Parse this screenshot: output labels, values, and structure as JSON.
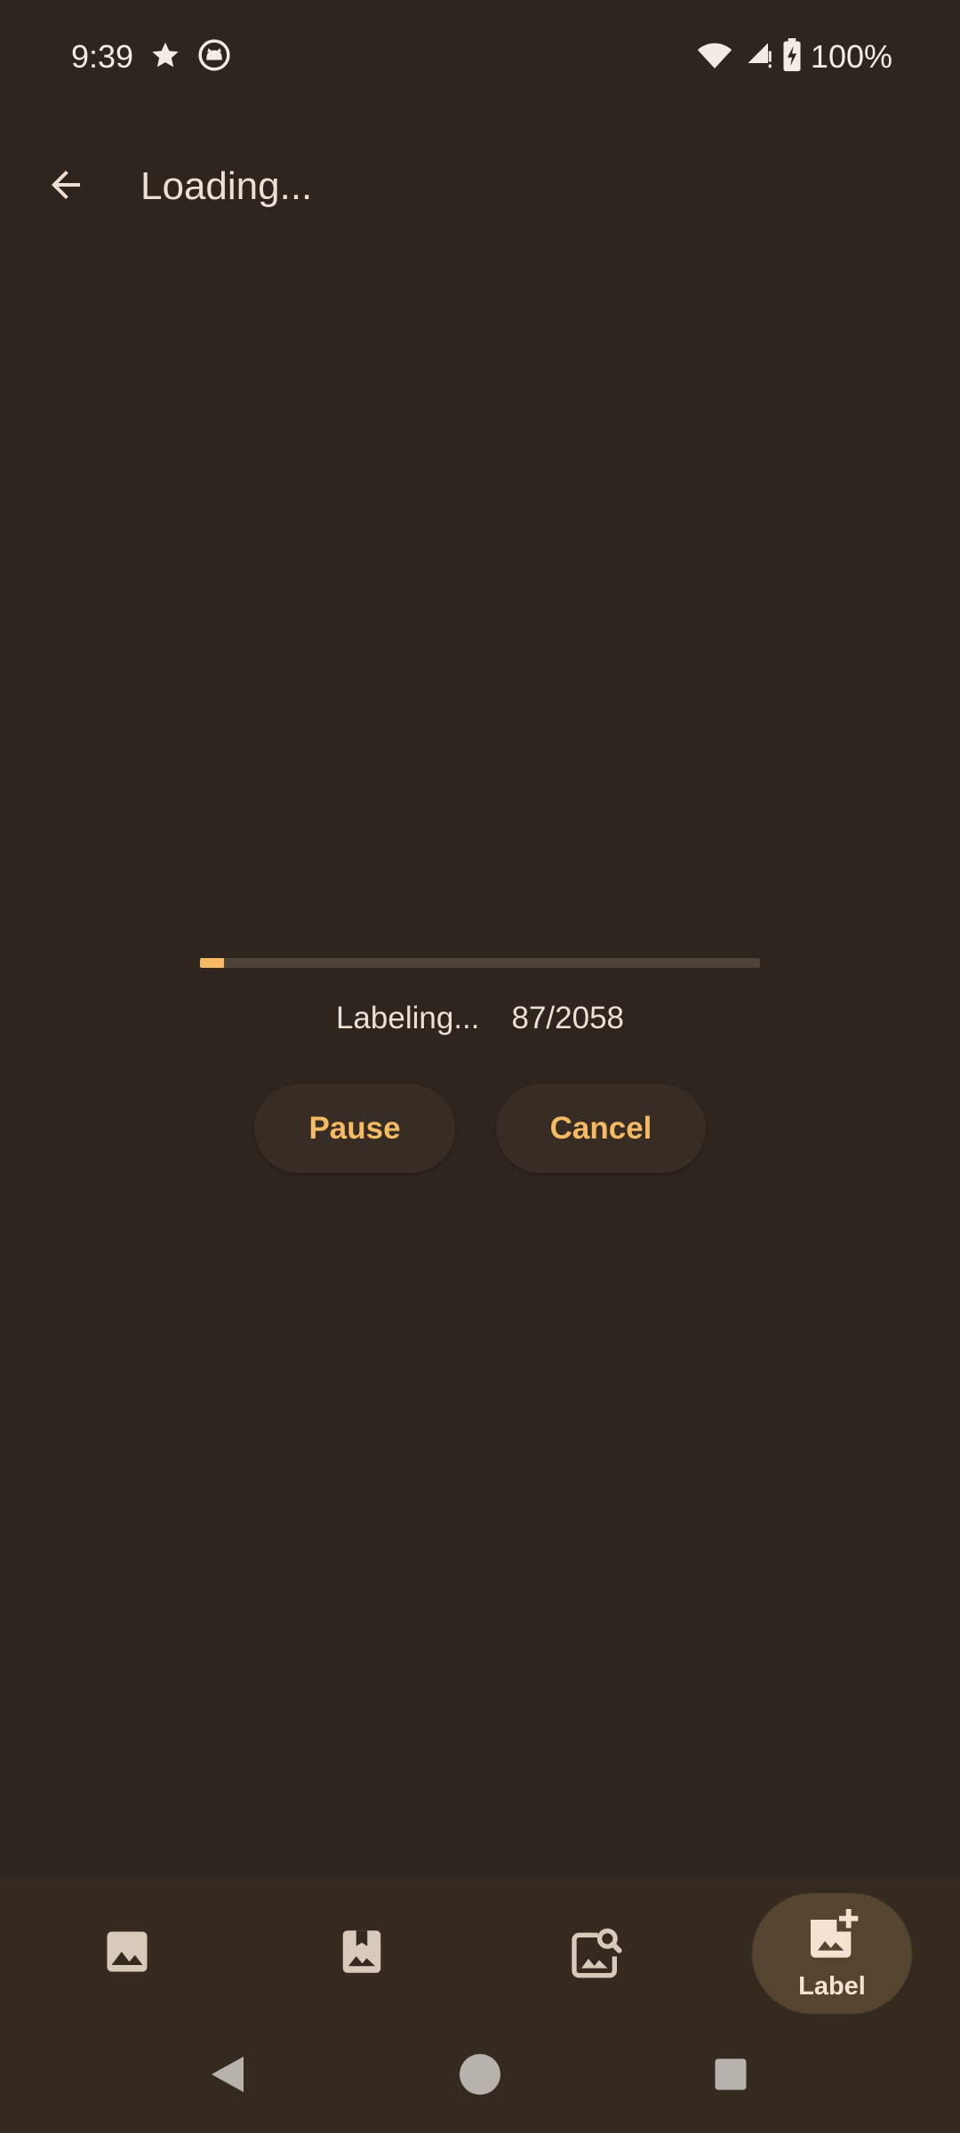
{
  "status_bar": {
    "time": "9:39",
    "battery_percent": "100%",
    "left_icons": [
      "star-icon",
      "cat-face-icon"
    ],
    "right_icons": [
      "wifi-icon",
      "cellular-signal-icon",
      "battery-charging-icon"
    ]
  },
  "app_bar": {
    "title": "Loading...",
    "back_icon": "arrow-back-icon"
  },
  "labeling": {
    "status_label": "Labeling...",
    "progress_count": "87/2058",
    "progress_fraction": 0.0423
  },
  "actions": {
    "pause_label": "Pause",
    "cancel_label": "Cancel"
  },
  "bottom_nav": {
    "items": [
      {
        "icon": "image-icon",
        "label": ""
      },
      {
        "icon": "bookmark-image-icon",
        "label": ""
      },
      {
        "icon": "image-search-icon",
        "label": ""
      },
      {
        "icon": "add-image-icon",
        "label": "Label",
        "selected": true
      }
    ]
  },
  "system_nav": {
    "buttons": [
      "back-triangle-icon",
      "home-circle-icon",
      "recents-square-icon"
    ]
  },
  "colors": {
    "background": "#2E251E",
    "accent": "#F5BA62",
    "nav_background": "#352A20",
    "selected_pill": "#55452F"
  }
}
